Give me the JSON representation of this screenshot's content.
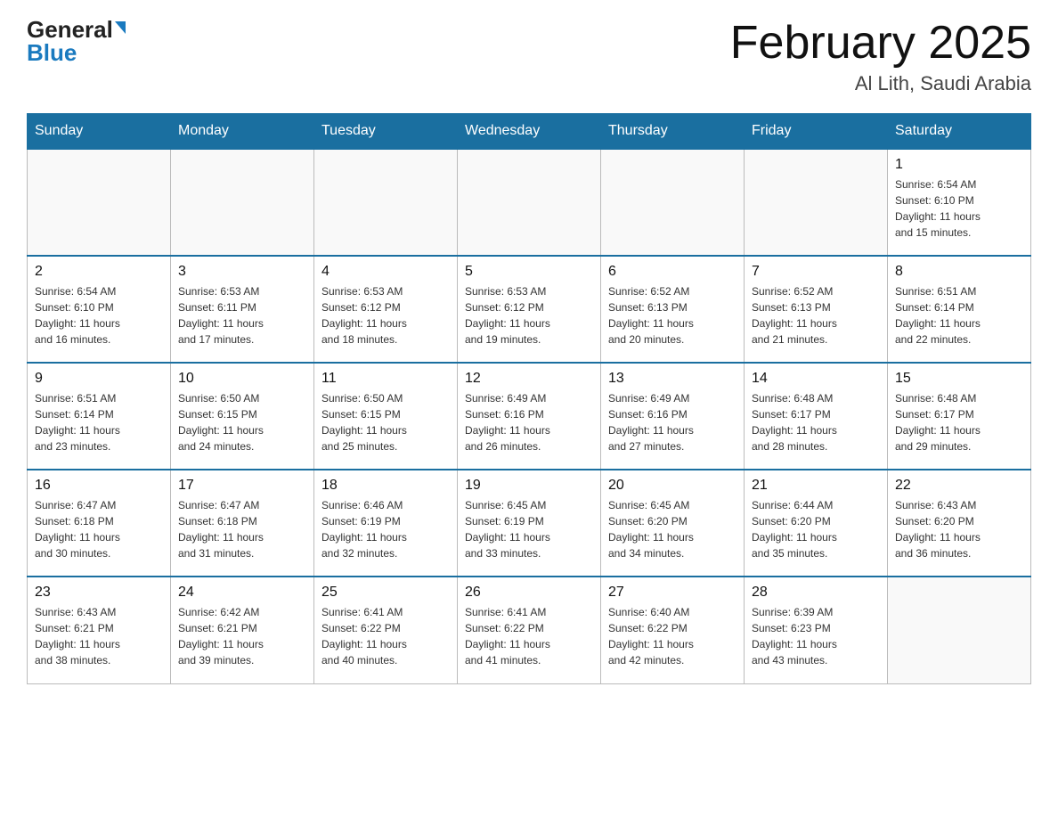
{
  "header": {
    "logo_general": "General",
    "logo_blue": "Blue",
    "month_title": "February 2025",
    "location": "Al Lith, Saudi Arabia"
  },
  "weekdays": [
    "Sunday",
    "Monday",
    "Tuesday",
    "Wednesday",
    "Thursday",
    "Friday",
    "Saturday"
  ],
  "weeks": [
    [
      {
        "day": "",
        "info": ""
      },
      {
        "day": "",
        "info": ""
      },
      {
        "day": "",
        "info": ""
      },
      {
        "day": "",
        "info": ""
      },
      {
        "day": "",
        "info": ""
      },
      {
        "day": "",
        "info": ""
      },
      {
        "day": "1",
        "info": "Sunrise: 6:54 AM\nSunset: 6:10 PM\nDaylight: 11 hours\nand 15 minutes."
      }
    ],
    [
      {
        "day": "2",
        "info": "Sunrise: 6:54 AM\nSunset: 6:10 PM\nDaylight: 11 hours\nand 16 minutes."
      },
      {
        "day": "3",
        "info": "Sunrise: 6:53 AM\nSunset: 6:11 PM\nDaylight: 11 hours\nand 17 minutes."
      },
      {
        "day": "4",
        "info": "Sunrise: 6:53 AM\nSunset: 6:12 PM\nDaylight: 11 hours\nand 18 minutes."
      },
      {
        "day": "5",
        "info": "Sunrise: 6:53 AM\nSunset: 6:12 PM\nDaylight: 11 hours\nand 19 minutes."
      },
      {
        "day": "6",
        "info": "Sunrise: 6:52 AM\nSunset: 6:13 PM\nDaylight: 11 hours\nand 20 minutes."
      },
      {
        "day": "7",
        "info": "Sunrise: 6:52 AM\nSunset: 6:13 PM\nDaylight: 11 hours\nand 21 minutes."
      },
      {
        "day": "8",
        "info": "Sunrise: 6:51 AM\nSunset: 6:14 PM\nDaylight: 11 hours\nand 22 minutes."
      }
    ],
    [
      {
        "day": "9",
        "info": "Sunrise: 6:51 AM\nSunset: 6:14 PM\nDaylight: 11 hours\nand 23 minutes."
      },
      {
        "day": "10",
        "info": "Sunrise: 6:50 AM\nSunset: 6:15 PM\nDaylight: 11 hours\nand 24 minutes."
      },
      {
        "day": "11",
        "info": "Sunrise: 6:50 AM\nSunset: 6:15 PM\nDaylight: 11 hours\nand 25 minutes."
      },
      {
        "day": "12",
        "info": "Sunrise: 6:49 AM\nSunset: 6:16 PM\nDaylight: 11 hours\nand 26 minutes."
      },
      {
        "day": "13",
        "info": "Sunrise: 6:49 AM\nSunset: 6:16 PM\nDaylight: 11 hours\nand 27 minutes."
      },
      {
        "day": "14",
        "info": "Sunrise: 6:48 AM\nSunset: 6:17 PM\nDaylight: 11 hours\nand 28 minutes."
      },
      {
        "day": "15",
        "info": "Sunrise: 6:48 AM\nSunset: 6:17 PM\nDaylight: 11 hours\nand 29 minutes."
      }
    ],
    [
      {
        "day": "16",
        "info": "Sunrise: 6:47 AM\nSunset: 6:18 PM\nDaylight: 11 hours\nand 30 minutes."
      },
      {
        "day": "17",
        "info": "Sunrise: 6:47 AM\nSunset: 6:18 PM\nDaylight: 11 hours\nand 31 minutes."
      },
      {
        "day": "18",
        "info": "Sunrise: 6:46 AM\nSunset: 6:19 PM\nDaylight: 11 hours\nand 32 minutes."
      },
      {
        "day": "19",
        "info": "Sunrise: 6:45 AM\nSunset: 6:19 PM\nDaylight: 11 hours\nand 33 minutes."
      },
      {
        "day": "20",
        "info": "Sunrise: 6:45 AM\nSunset: 6:20 PM\nDaylight: 11 hours\nand 34 minutes."
      },
      {
        "day": "21",
        "info": "Sunrise: 6:44 AM\nSunset: 6:20 PM\nDaylight: 11 hours\nand 35 minutes."
      },
      {
        "day": "22",
        "info": "Sunrise: 6:43 AM\nSunset: 6:20 PM\nDaylight: 11 hours\nand 36 minutes."
      }
    ],
    [
      {
        "day": "23",
        "info": "Sunrise: 6:43 AM\nSunset: 6:21 PM\nDaylight: 11 hours\nand 38 minutes."
      },
      {
        "day": "24",
        "info": "Sunrise: 6:42 AM\nSunset: 6:21 PM\nDaylight: 11 hours\nand 39 minutes."
      },
      {
        "day": "25",
        "info": "Sunrise: 6:41 AM\nSunset: 6:22 PM\nDaylight: 11 hours\nand 40 minutes."
      },
      {
        "day": "26",
        "info": "Sunrise: 6:41 AM\nSunset: 6:22 PM\nDaylight: 11 hours\nand 41 minutes."
      },
      {
        "day": "27",
        "info": "Sunrise: 6:40 AM\nSunset: 6:22 PM\nDaylight: 11 hours\nand 42 minutes."
      },
      {
        "day": "28",
        "info": "Sunrise: 6:39 AM\nSunset: 6:23 PM\nDaylight: 11 hours\nand 43 minutes."
      },
      {
        "day": "",
        "info": ""
      }
    ]
  ]
}
